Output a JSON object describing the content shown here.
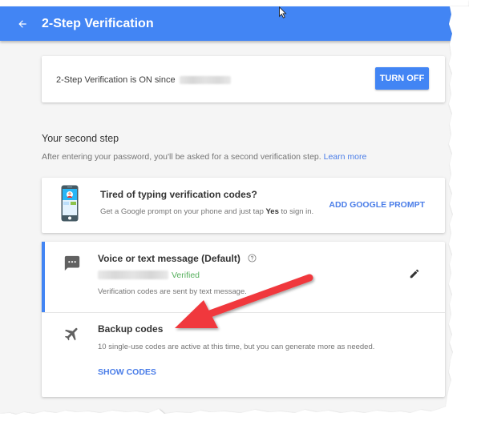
{
  "appbar": {
    "title": "2-Step Verification",
    "back_icon": "arrow-left-icon",
    "color": "#4285f4"
  },
  "status_card": {
    "text": "2-Step Verification is ON since",
    "date_redacted": true,
    "turn_off_label": "TURN OFF"
  },
  "second_step": {
    "title": "Your second step",
    "description": "After entering your password, you'll be asked for a second verification step.",
    "learn_more": "Learn more"
  },
  "prompt_card": {
    "icon": "phone-icon",
    "title": "Tired of typing verification codes?",
    "desc_before": "Get a Google prompt on your phone and just tap ",
    "desc_bold": "Yes",
    "desc_after": " to sign in.",
    "action_label": "ADD GOOGLE PROMPT"
  },
  "methods": [
    {
      "icon": "sms-icon",
      "title": "Voice or text message (Default)",
      "phone_redacted": true,
      "status": "Verified",
      "status_color": "#57b05e",
      "description": "Verification codes are sent by text message."
    },
    {
      "icon": "airplane-icon",
      "title": "Backup codes",
      "description": "10 single-use codes are active at this time, but you can generate more as needed.",
      "action_label": "SHOW CODES"
    }
  ],
  "annotation": {
    "type": "red-arrow",
    "points_to": "Backup codes",
    "color": "#f0373c"
  },
  "colors": {
    "accent": "#4285f4",
    "link": "#4a7de8",
    "verified": "#57b05e"
  }
}
